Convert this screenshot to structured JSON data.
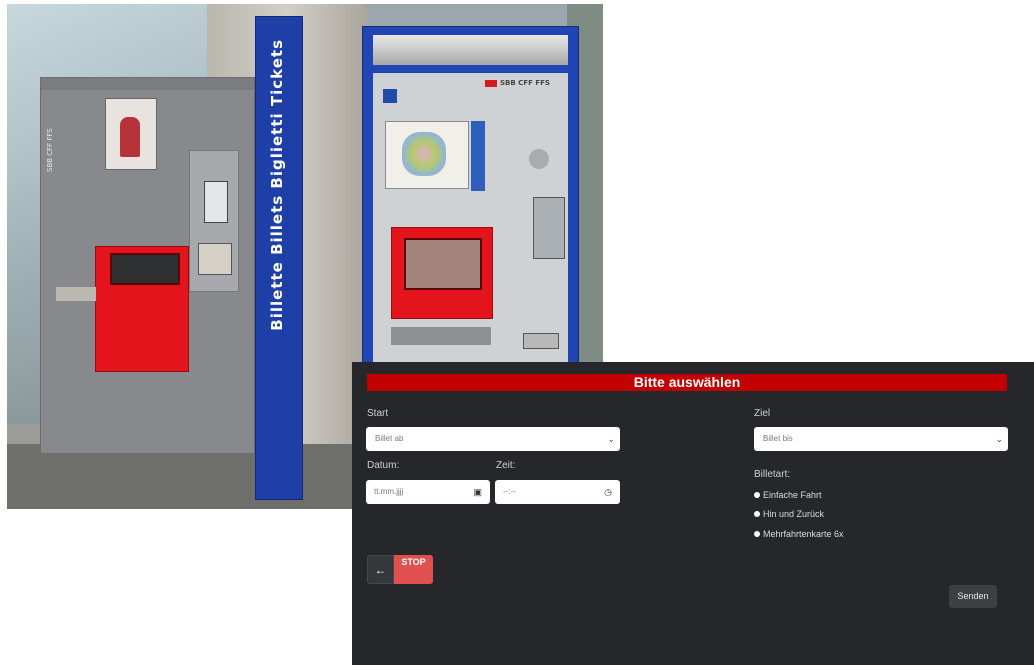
{
  "photo": {
    "machine1_brand": "SBB CFF FFS",
    "pole_text": "Billette Billets Biglietti Tickets",
    "machine2_brand": "SBB CFF FFS"
  },
  "form": {
    "title": "Bitte auswählen",
    "start_label": "Start",
    "start_select": "Billet ab",
    "ziel_label": "Ziel",
    "ziel_select": "Billet bis",
    "datum_label": "Datum:",
    "datum_placeholder": "tt.mm.jjjj",
    "zeit_label": "Zeit:",
    "zeit_placeholder": "--:--",
    "billetart_label": "Billetart:",
    "options": [
      "Einfache Fahrt",
      "Hin und Zurück",
      "Mehrfahrtenkarte 6x"
    ],
    "back_icon": "←",
    "stop_label": "STOP",
    "send_label": "Senden"
  },
  "colors": {
    "header_red": "#c30000",
    "panel_bg": "#25272b",
    "stop_red": "#e05050"
  }
}
